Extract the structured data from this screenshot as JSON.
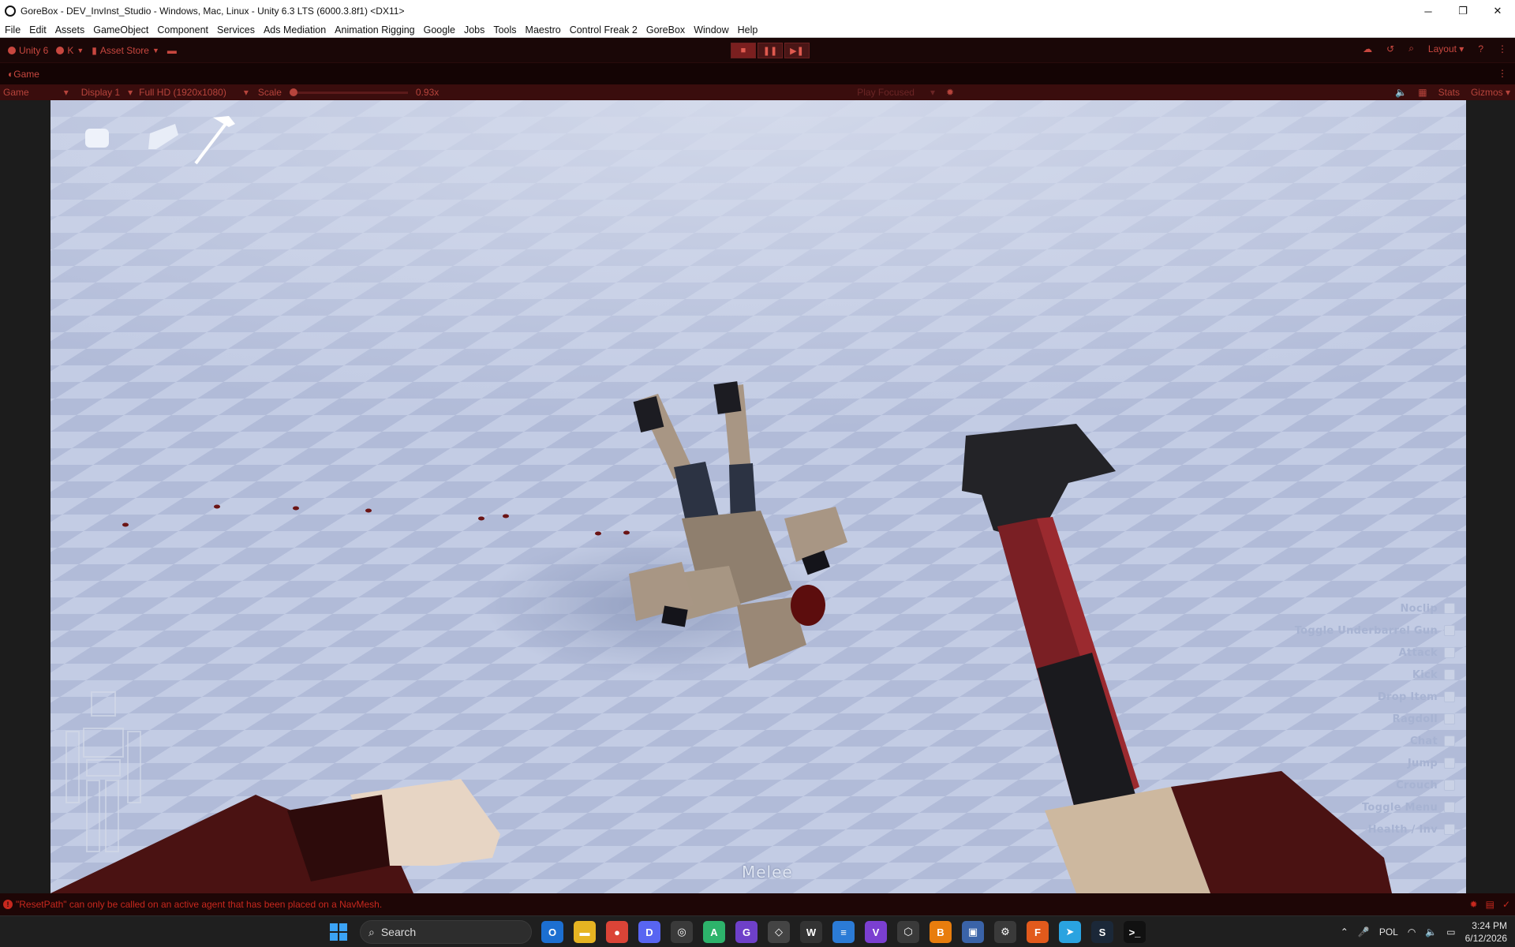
{
  "window": {
    "title": "GoreBox - DEV_InvInst_Studio - Windows, Mac, Linux - Unity 6.3 LTS (6000.3.8f1) <DX11>",
    "minimize": "─",
    "maximize": "❐",
    "close": "✕"
  },
  "menu": [
    "File",
    "Edit",
    "Assets",
    "GameObject",
    "Component",
    "Services",
    "Ads Mediation",
    "Animation Rigging",
    "Google",
    "Jobs",
    "Tools",
    "Maestro",
    "Control Freak 2",
    "GoreBox",
    "Window",
    "Help"
  ],
  "toolbar": {
    "unity_label": "Unity 6",
    "account_label": "K",
    "asset_store_label": "Asset Store",
    "layout_label": "Layout",
    "play_buttons": [
      "■",
      "❚❚",
      "▶❚"
    ]
  },
  "tab": {
    "label": "Game"
  },
  "gamebar": {
    "mode": "Game",
    "display": "Display 1",
    "resolution": "Full HD (1920x1080)",
    "scale_label": "Scale",
    "scale_value": "0.93x",
    "play_focus": "Play Focused",
    "stats": "Stats",
    "gizmos": "Gizmos"
  },
  "hud": {
    "weapon_label": "Melee",
    "controls": [
      {
        "label": "Noclip"
      },
      {
        "label": "Toggle Underbarrel Gun"
      },
      {
        "label": "Attack"
      },
      {
        "label": "Kick"
      },
      {
        "label": "Drop Item"
      },
      {
        "label": "Ragdoll"
      },
      {
        "label": "Chat"
      },
      {
        "label": "Jump"
      },
      {
        "label": "Crouch"
      },
      {
        "label": "Toggle Menu"
      },
      {
        "label": "Health / Inv"
      }
    ]
  },
  "console": {
    "message": "\"ResetPath\" can only be called on an active agent that has been placed on a NavMesh."
  },
  "taskbar": {
    "search_placeholder": "Search",
    "language": "POL",
    "time": "3:24 PM",
    "date": "6/12/2026",
    "apps": [
      {
        "name": "outlook",
        "glyph": "O",
        "color": "#1c6fd1"
      },
      {
        "name": "explorer",
        "glyph": "▬",
        "color": "#e6b422"
      },
      {
        "name": "chrome",
        "glyph": "●",
        "color": "#db4437"
      },
      {
        "name": "discord",
        "glyph": "D",
        "color": "#5865f2"
      },
      {
        "name": "obs",
        "glyph": "◎",
        "color": "#3a3a3a"
      },
      {
        "name": "android-studio",
        "glyph": "A",
        "color": "#2db36b"
      },
      {
        "name": "github",
        "glyph": "G",
        "color": "#6e40c9"
      },
      {
        "name": "unity-hub",
        "glyph": "◇",
        "color": "#444"
      },
      {
        "name": "wordpad",
        "glyph": "W",
        "color": "#333"
      },
      {
        "name": "notepad",
        "glyph": "≡",
        "color": "#2b7bd6"
      },
      {
        "name": "visual-studio",
        "glyph": "V",
        "color": "#7b3fd1"
      },
      {
        "name": "unity",
        "glyph": "⬡",
        "color": "#3a3a3a"
      },
      {
        "name": "blender",
        "glyph": "B",
        "color": "#e87d0d"
      },
      {
        "name": "paint",
        "glyph": "▣",
        "color": "#3a63a8"
      },
      {
        "name": "settings",
        "glyph": "⚙",
        "color": "#3a3a3a"
      },
      {
        "name": "firefox",
        "glyph": "F",
        "color": "#e25a1c"
      },
      {
        "name": "telegram",
        "glyph": "➤",
        "color": "#2aa3e0"
      },
      {
        "name": "steam",
        "glyph": "S",
        "color": "#1b2838"
      },
      {
        "name": "terminal",
        "glyph": ">_",
        "color": "#111"
      }
    ]
  },
  "colors": {
    "editor_accent": "#c8473f",
    "floor_light": "#c6cfe6",
    "floor_dark": "#aeb8d6"
  }
}
